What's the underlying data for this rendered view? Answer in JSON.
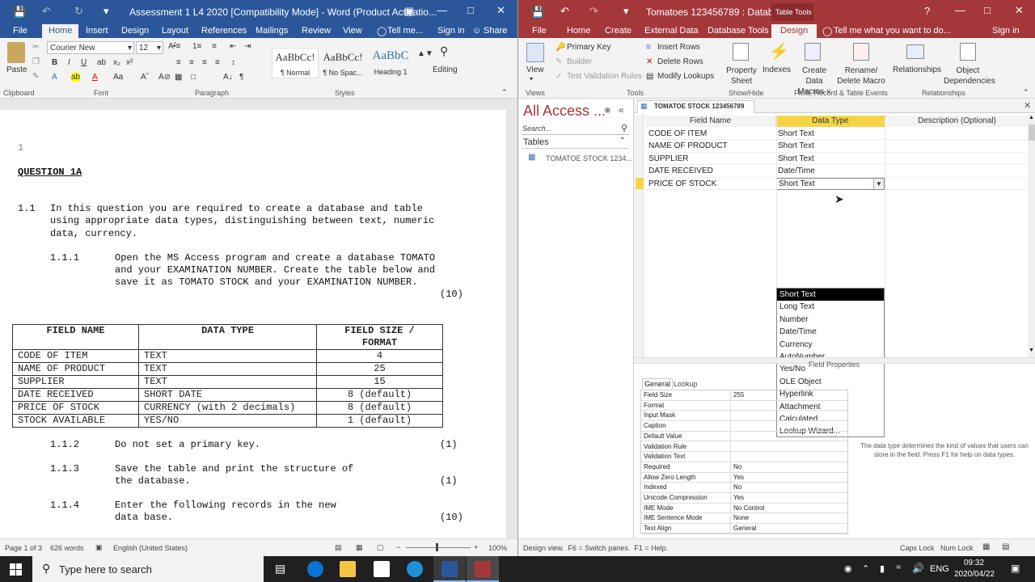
{
  "word": {
    "title": "Assessment 1 L4 2020 [Compatibility Mode] - Word (Product Activatio...",
    "tabs": [
      "File",
      "Home",
      "Insert",
      "Design",
      "Layout",
      "References",
      "Mailings",
      "Review",
      "View"
    ],
    "tell_me": "Tell me...",
    "sign_in": "Sign in",
    "share": "Share",
    "font_name": "Courier New",
    "font_size": "12",
    "paste_label": "Paste",
    "editing_label": "Editing",
    "groups": [
      "Clipboard",
      "Font",
      "Paragraph",
      "Styles"
    ],
    "styles": [
      {
        "preview": "AaBbCc!",
        "name": "¶ Normal"
      },
      {
        "preview": "AaBbCc!",
        "name": "¶ No Spac..."
      },
      {
        "preview": "AaBbC",
        "name": "Heading 1"
      }
    ],
    "doc": {
      "page_num": "1",
      "heading": "QUESTION 1A",
      "p1_num": "1.1",
      "p1_lines": [
        "In this question you are required to create a database and table",
        "using appropriate data types, distinguishing between text, numeric",
        "data, currency."
      ],
      "p2_num": "1.1.1",
      "p2_lines": [
        "Open the MS Access program and create a database TOMATO",
        "and your EXAMINATION NUMBER. Create the table below and",
        "save it as TOMATO STOCK and your EXAMINATION NUMBER."
      ],
      "p2_marks": "(10)",
      "table_headers": [
        "FIELD NAME",
        "DATA TYPE",
        "FIELD SIZE /",
        "FORMAT"
      ],
      "table_rows": [
        [
          "CODE OF ITEM",
          "TEXT",
          "4"
        ],
        [
          "NAME OF PRODUCT",
          "TEXT",
          "25"
        ],
        [
          "SUPPLIER",
          "TEXT",
          "15"
        ],
        [
          "DATE RECEIVED",
          "SHORT DATE",
          "8 (default)"
        ],
        [
          "PRICE OF STOCK",
          "CURRENCY (with 2 decimals)",
          "8 (default)"
        ],
        [
          "STOCK AVAILABLE",
          "YES/NO",
          "1 (default)"
        ]
      ],
      "p3_num": "1.1.2",
      "p3_text": "Do not set a primary key.",
      "p3_marks": "(1)",
      "p4_num": "1.1.3",
      "p4_lines": [
        "Save the table and print the structure of",
        "the database."
      ],
      "p4_marks": "(1)",
      "p5_num": "1.1.4",
      "p5_lines": [
        "Enter the following records in the new",
        "data base."
      ],
      "p5_marks": "(10)"
    },
    "status": {
      "page": "Page 1 of 3",
      "words": "626 words",
      "lang": "English (United States)",
      "zoom": "100%"
    }
  },
  "access": {
    "title": "Tomatoes 123456789 : Databas...",
    "context_tab": "Table Tools",
    "tabs": [
      "File",
      "Home",
      "Create",
      "External Data",
      "Database Tools",
      "Design"
    ],
    "tell_me": "Tell me what you want to do...",
    "sign_in": "Sign in",
    "ribbon": {
      "view": "View",
      "primary_key": "Primary Key",
      "builder": "Builder",
      "test_validation": "Test Validation Rules",
      "insert_rows": "Insert Rows",
      "delete_rows": "Delete Rows",
      "modify_lookups": "Modify Lookups",
      "property_sheet": [
        "Property",
        "Sheet"
      ],
      "indexes": "Indexes",
      "create_data_macros": [
        "Create Data",
        "Macros ˅"
      ],
      "rename_delete_macro": [
        "Rename/",
        "Delete Macro"
      ],
      "relationships": "Relationships",
      "object_dependencies": [
        "Object",
        "Dependencies"
      ],
      "groups": [
        "Views",
        "Tools",
        "Show/Hide",
        "Field, Record & Table Events",
        "Relationships"
      ]
    },
    "nav": {
      "title": "All Access ...",
      "search_placeholder": "Search...",
      "section": "Tables",
      "item": "TOMATOE STOCK 1234..."
    },
    "table_tab": "TOMATOE STOCK 123456789",
    "grid_headers": [
      "Field Name",
      "Data Type",
      "Description (Optional)"
    ],
    "grid_rows": [
      {
        "name": "CODE OF ITEM",
        "type": "Short Text"
      },
      {
        "name": "NAME OF PRODUCT",
        "type": "Short Text"
      },
      {
        "name": "SUPPLIER",
        "type": "Short Text"
      },
      {
        "name": "DATE RECEIVED",
        "type": "Date/Time"
      },
      {
        "name": "PRICE OF STOCK",
        "type": "Short Text"
      }
    ],
    "dropdown_options": [
      "Short Text",
      "Long Text",
      "Number",
      "Date/Time",
      "Currency",
      "AutoNumber",
      "Yes/No",
      "OLE Object",
      "Hyperlink",
      "Attachment",
      "Calculated",
      "Lookup Wizard..."
    ],
    "field_properties_title": "Field Properties",
    "fp_tabs": [
      "General",
      "Lookup"
    ],
    "fp_rows": [
      [
        "Field Size",
        "255"
      ],
      [
        "Format",
        ""
      ],
      [
        "Input Mask",
        ""
      ],
      [
        "Caption",
        ""
      ],
      [
        "Default Value",
        ""
      ],
      [
        "Validation Rule",
        ""
      ],
      [
        "Validation Text",
        ""
      ],
      [
        "Required",
        "No"
      ],
      [
        "Allow Zero Length",
        "Yes"
      ],
      [
        "Indexed",
        "No"
      ],
      [
        "Unicode Compression",
        "Yes"
      ],
      [
        "IME Mode",
        "No Control"
      ],
      [
        "IME Sentence Mode",
        "None"
      ],
      [
        "Text Align",
        "General"
      ]
    ],
    "help_text": "The data type determines the kind of values that users can store in the field. Press F1 for help on data types.",
    "status": {
      "left": "Design view.  F6 = Switch panes.  F1 = Help.",
      "caps": "Caps Lock",
      "num": "Num Lock"
    }
  },
  "taskbar": {
    "search": "Type here to search",
    "lang": "ENG",
    "time": "09:32",
    "date": "2020/04/22"
  }
}
